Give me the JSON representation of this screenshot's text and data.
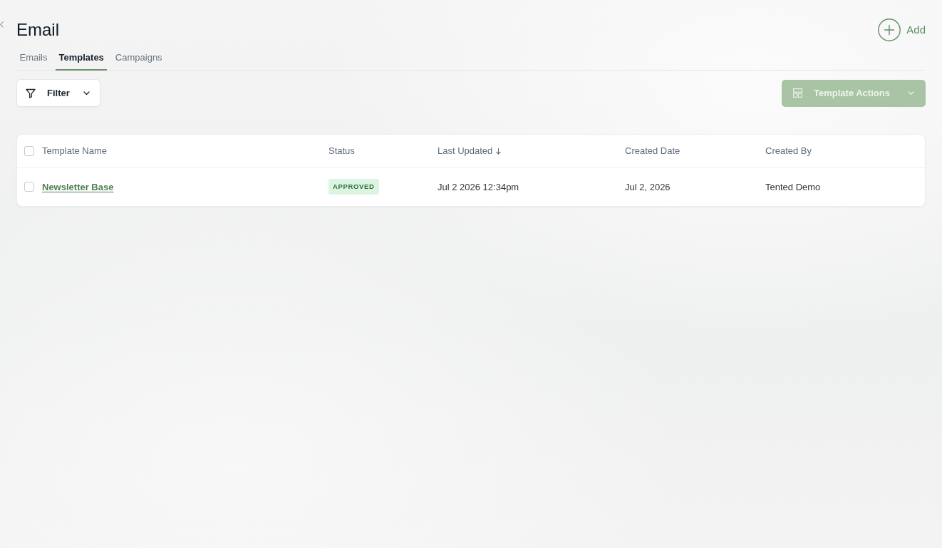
{
  "header": {
    "title": "Email",
    "add_button": {
      "label": "Add"
    }
  },
  "tabs": [
    {
      "label": "Emails",
      "selected": false
    },
    {
      "label": "Templates",
      "selected": true
    },
    {
      "label": "Campaigns",
      "selected": false
    }
  ],
  "toolbar": {
    "filter_button": {
      "label": "Filter"
    },
    "actions_button": {
      "label": "Template Actions",
      "disabled": true
    }
  },
  "table": {
    "select_all": {
      "checked": false
    },
    "columns": [
      {
        "label": "Template Name",
        "sorted": false
      },
      {
        "label": "Status",
        "sorted": false
      },
      {
        "label": "Last Updated",
        "sorted": true
      },
      {
        "label": "Created Date",
        "sorted": false
      },
      {
        "label": "Created By",
        "sorted": false
      }
    ],
    "rows": [
      {
        "checked": false,
        "name": "Newsletter Base",
        "status": {
          "label": "APPROVED",
          "kind": "approved"
        },
        "last_updated": "Jul 2 2026 12:34pm",
        "created_date": "Jul 2, 2026",
        "created_by": "Tented Demo"
      }
    ]
  }
}
